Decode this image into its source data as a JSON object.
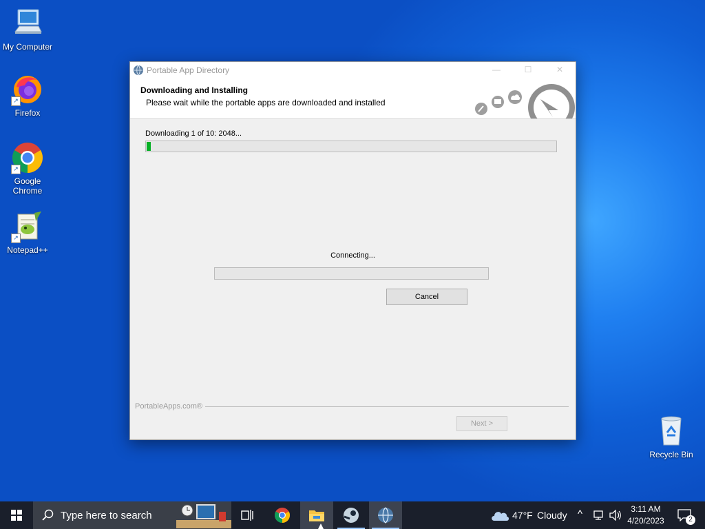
{
  "desktop": {
    "icons": [
      {
        "label": "My Computer"
      },
      {
        "label": "Firefox"
      },
      {
        "label": "Google Chrome"
      },
      {
        "label": "Notepad++"
      },
      {
        "label": "Recycle Bin"
      }
    ]
  },
  "dialog": {
    "title": "Portable App Directory",
    "header_title": "Downloading and Installing",
    "header_subtitle": "Please wait while the portable apps are downloaded and installed",
    "download_status": "Downloading 1 of 10: 2048...",
    "overall_progress": 0.01,
    "connection_status": "Connecting...",
    "connection_progress": 0,
    "cancel_label": "Cancel",
    "brand_text": "PortableApps.com®",
    "next_label": "Next >"
  },
  "taskbar": {
    "search_placeholder": "Type here to search",
    "weather_temp": "47°F",
    "weather_desc": "Cloudy",
    "time": "3:11 AM",
    "date": "4/20/2023",
    "notification_count": "2"
  },
  "colors": {
    "progress_green": "#06b025",
    "taskbar": "#1a1f2b",
    "desktop_accent": "#1f7ff0"
  }
}
